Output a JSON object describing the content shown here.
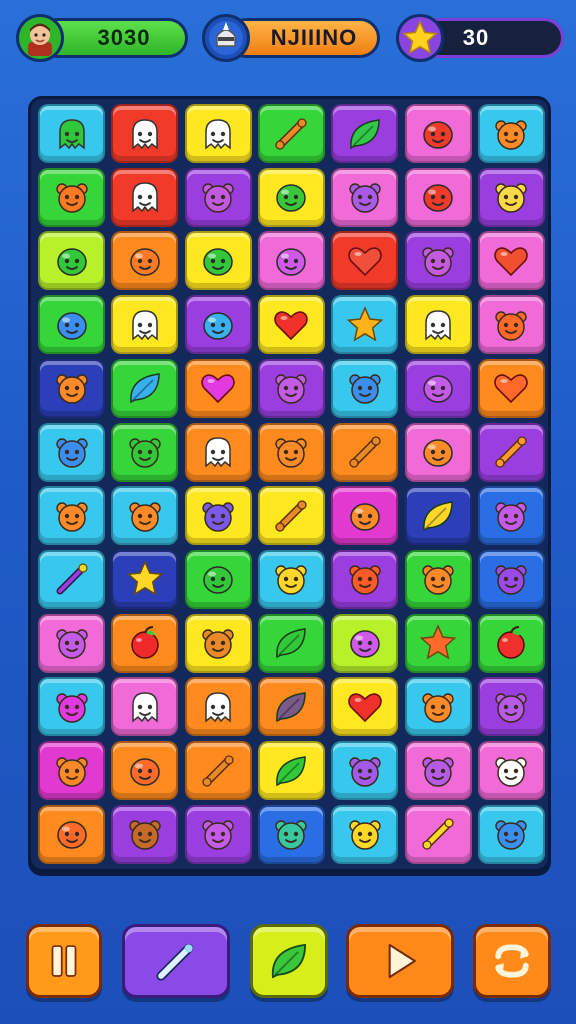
{
  "hud": {
    "player_score": "3030",
    "player_name": "NJIIINO",
    "stars": "30",
    "icons": {
      "left": "player-avatar-icon",
      "middle": "knight-helmet-icon",
      "right": "star-icon"
    }
  },
  "palette": {
    "G": "#36d63a",
    "R": "#f23a2a",
    "Y": "#ffe81f",
    "P": "#9a3ee0",
    "M": "#f06ad8",
    "C": "#38c8ee",
    "O": "#ff8a1e",
    "L": "#b8f02a",
    "B": "#2a6ee6",
    "D": "#2a3fb8",
    "N": "#e23ad0"
  },
  "board": {
    "rows": 12,
    "cols": 7,
    "tiles": [
      [
        {
          "bg": "C",
          "icon": "ghost",
          "ic": "#2fc83a"
        },
        {
          "bg": "R",
          "icon": "ghost",
          "ic": "#ffffff"
        },
        {
          "bg": "Y",
          "icon": "ghost",
          "ic": "#ffffff"
        },
        {
          "bg": "G",
          "icon": "bone",
          "ic": "#e8892a"
        },
        {
          "bg": "P",
          "icon": "leaf",
          "ic": "#32c84a"
        },
        {
          "bg": "M",
          "icon": "blob",
          "ic": "#f03a2a"
        },
        {
          "bg": "C",
          "icon": "bear",
          "ic": "#ff8a2a"
        }
      ],
      [
        {
          "bg": "G",
          "icon": "bear",
          "ic": "#ff7a24"
        },
        {
          "bg": "R",
          "icon": "ghost",
          "ic": "#ffffff"
        },
        {
          "bg": "P",
          "icon": "bear",
          "ic": "#c15ae0"
        },
        {
          "bg": "Y",
          "icon": "blob",
          "ic": "#3ac83a"
        },
        {
          "bg": "M",
          "icon": "bear",
          "ic": "#a85ae8"
        },
        {
          "bg": "M",
          "icon": "blob",
          "ic": "#f03a2a"
        },
        {
          "bg": "P",
          "icon": "bear",
          "ic": "#ffd84a"
        }
      ],
      [
        {
          "bg": "L",
          "icon": "blob",
          "ic": "#32c83a"
        },
        {
          "bg": "O",
          "icon": "blob",
          "ic": "#ff7a24"
        },
        {
          "bg": "Y",
          "icon": "blob",
          "ic": "#32c83a"
        },
        {
          "bg": "M",
          "icon": "blob",
          "ic": "#d05ae8"
        },
        {
          "bg": "R",
          "icon": "heart",
          "ic": "#f0503a"
        },
        {
          "bg": "P",
          "icon": "bear",
          "ic": "#c35ae0"
        },
        {
          "bg": "M",
          "icon": "heart",
          "ic": "#f05030"
        }
      ],
      [
        {
          "bg": "G",
          "icon": "blob",
          "ic": "#3a8ef0"
        },
        {
          "bg": "Y",
          "icon": "ghost",
          "ic": "#ffffff"
        },
        {
          "bg": "P",
          "icon": "blob",
          "ic": "#3ab0f0"
        },
        {
          "bg": "Y",
          "icon": "heart",
          "ic": "#f0302a"
        },
        {
          "bg": "C",
          "icon": "star",
          "ic": "#ffb21a"
        },
        {
          "bg": "Y",
          "icon": "ghost",
          "ic": "#ffffff"
        },
        {
          "bg": "M",
          "icon": "bear",
          "ic": "#ff6a2a"
        }
      ],
      [
        {
          "bg": "D",
          "icon": "bear",
          "ic": "#ff8a2a"
        },
        {
          "bg": "G",
          "icon": "leaf",
          "ic": "#38b0f0"
        },
        {
          "bg": "O",
          "icon": "heart",
          "ic": "#e03ae0"
        },
        {
          "bg": "P",
          "icon": "bear",
          "ic": "#c45ae8"
        },
        {
          "bg": "C",
          "icon": "bear",
          "ic": "#3a8ef0"
        },
        {
          "bg": "P",
          "icon": "blob",
          "ic": "#c45ae8"
        },
        {
          "bg": "O",
          "icon": "heart",
          "ic": "#ff6a2a"
        }
      ],
      [
        {
          "bg": "C",
          "icon": "bear",
          "ic": "#3a8ef0"
        },
        {
          "bg": "G",
          "icon": "bear",
          "ic": "#32c83a"
        },
        {
          "bg": "O",
          "icon": "ghost",
          "ic": "#ffffff"
        },
        {
          "bg": "O",
          "icon": "bear",
          "ic": "#ff8a2a"
        },
        {
          "bg": "O",
          "icon": "bone",
          "ic": "#e8892a"
        },
        {
          "bg": "M",
          "icon": "blob",
          "ic": "#ff8a2a"
        },
        {
          "bg": "P",
          "icon": "bone",
          "ic": "#ff9a2a"
        }
      ],
      [
        {
          "bg": "C",
          "icon": "bear",
          "ic": "#ff8a2a"
        },
        {
          "bg": "C",
          "icon": "bear",
          "ic": "#ff8a2a"
        },
        {
          "bg": "Y",
          "icon": "bear",
          "ic": "#7a5ae8"
        },
        {
          "bg": "Y",
          "icon": "bone",
          "ic": "#e8892a"
        },
        {
          "bg": "N",
          "icon": "blob",
          "ic": "#ff8a2a"
        },
        {
          "bg": "D",
          "icon": "leaf",
          "ic": "#ffd82a"
        },
        {
          "bg": "B",
          "icon": "bear",
          "ic": "#c45ae8"
        }
      ],
      [
        {
          "bg": "C",
          "icon": "wand",
          "ic": "#9a3ee0"
        },
        {
          "bg": "D",
          "icon": "star",
          "ic": "#ffd82a"
        },
        {
          "bg": "G",
          "icon": "blob",
          "ic": "#32c83a"
        },
        {
          "bg": "C",
          "icon": "bear",
          "ic": "#ffd82a"
        },
        {
          "bg": "P",
          "icon": "bear",
          "ic": "#ff5a2a"
        },
        {
          "bg": "G",
          "icon": "bear",
          "ic": "#ff8a2a"
        },
        {
          "bg": "B",
          "icon": "bear",
          "ic": "#9a4ae8"
        }
      ],
      [
        {
          "bg": "M",
          "icon": "bear",
          "ic": "#c45ae8"
        },
        {
          "bg": "O",
          "icon": "apple",
          "ic": "#f02a2a"
        },
        {
          "bg": "Y",
          "icon": "bear",
          "ic": "#e8892a"
        },
        {
          "bg": "G",
          "icon": "leaf",
          "ic": "#32c83a"
        },
        {
          "bg": "L",
          "icon": "blob",
          "ic": "#d05ae8"
        },
        {
          "bg": "G",
          "icon": "star",
          "ic": "#ff6a2a"
        },
        {
          "bg": "G",
          "icon": "apple",
          "ic": "#f0302a"
        }
      ],
      [
        {
          "bg": "C",
          "icon": "bear",
          "ic": "#e03ae0"
        },
        {
          "bg": "M",
          "icon": "ghost",
          "ic": "#ffffff"
        },
        {
          "bg": "O",
          "icon": "ghost",
          "ic": "#ffffff"
        },
        {
          "bg": "O",
          "icon": "leaf",
          "ic": "#7a5a8a"
        },
        {
          "bg": "Y",
          "icon": "heart",
          "ic": "#f0302a"
        },
        {
          "bg": "C",
          "icon": "bear",
          "ic": "#ff8a2a"
        },
        {
          "bg": "P",
          "icon": "bear",
          "ic": "#b85ae8"
        }
      ],
      [
        {
          "bg": "N",
          "icon": "bear",
          "ic": "#ff8a2a"
        },
        {
          "bg": "O",
          "icon": "blob",
          "ic": "#ff6a2a"
        },
        {
          "bg": "O",
          "icon": "bone",
          "ic": "#e8892a"
        },
        {
          "bg": "Y",
          "icon": "leaf",
          "ic": "#32c83a"
        },
        {
          "bg": "C",
          "icon": "bear",
          "ic": "#a45ae8"
        },
        {
          "bg": "M",
          "icon": "bear",
          "ic": "#b85ae8"
        },
        {
          "bg": "M",
          "icon": "bear",
          "ic": "#ffffff"
        }
      ],
      [
        {
          "bg": "O",
          "icon": "blob",
          "ic": "#ff6a2a"
        },
        {
          "bg": "P",
          "icon": "bear",
          "ic": "#c46a2a"
        },
        {
          "bg": "P",
          "icon": "bear",
          "ic": "#c45ae8"
        },
        {
          "bg": "B",
          "icon": "bear",
          "ic": "#38c8a0"
        },
        {
          "bg": "C",
          "icon": "bear",
          "ic": "#ffd82a"
        },
        {
          "bg": "M",
          "icon": "bone",
          "ic": "#ffd82a"
        },
        {
          "bg": "C",
          "icon": "bear",
          "ic": "#3a8ef0"
        }
      ]
    ]
  },
  "controls": [
    {
      "name": "pause",
      "icon": "pause-icon",
      "bg": "#ff9a1a"
    },
    {
      "name": "wand-booster",
      "icon": "wand-icon",
      "bg": "#8a4ae8"
    },
    {
      "name": "leaf-booster",
      "icon": "leaf-icon",
      "bg": "#d8ee1a"
    },
    {
      "name": "play",
      "icon": "play-icon",
      "bg": "#ff8a1a"
    },
    {
      "name": "shuffle",
      "icon": "shuffle-icon",
      "bg": "#ff8a1a"
    }
  ]
}
